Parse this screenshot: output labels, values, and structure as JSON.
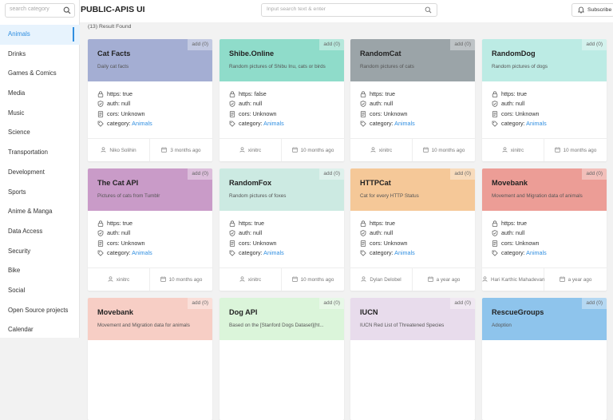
{
  "sidebar": {
    "search_placeholder": "search category",
    "items": [
      {
        "label": "Animals",
        "active": true
      },
      {
        "label": "Drinks"
      },
      {
        "label": "Games & Comics"
      },
      {
        "label": "Media"
      },
      {
        "label": "Music"
      },
      {
        "label": "Science"
      },
      {
        "label": "Transportation"
      },
      {
        "label": "Development"
      },
      {
        "label": "Sports"
      },
      {
        "label": "Anime & Manga"
      },
      {
        "label": "Data Access"
      },
      {
        "label": "Security"
      },
      {
        "label": "Bike"
      },
      {
        "label": "Social"
      },
      {
        "label": "Open Source projects"
      },
      {
        "label": "Calendar"
      }
    ]
  },
  "header": {
    "title": "PUBLIC-APIS UI",
    "search_placeholder": "Input search text & enter",
    "subscribe_label": "Subscribe"
  },
  "results": {
    "count_text": "(13) Result Found"
  },
  "labels": {
    "https_prefix": "https: ",
    "auth_prefix": "auth: ",
    "cors_prefix": "cors: ",
    "category_prefix": "category: "
  },
  "cards": [
    {
      "title": "Cat Facts",
      "desc": "Daily cat facts",
      "color": "#a4aed3",
      "add": "add (0)",
      "https": "true",
      "auth": "null",
      "cors": "Unknown",
      "category": "Animals",
      "author": "Niko Solihin",
      "time": "3 months ago"
    },
    {
      "title": "Shibe.Online",
      "desc": "Random pictures of Shibu Inu, cats or birds",
      "color": "#8fdcca",
      "add": "add (0)",
      "https": "false",
      "auth": "null",
      "cors": "Unknown",
      "category": "Animals",
      "author": "xinitrc",
      "time": "10 months ago"
    },
    {
      "title": "RandomCat",
      "desc": "Random pictures of cats",
      "color": "#9ba4a8",
      "add": "add (0)",
      "https": "true",
      "auth": "null",
      "cors": "Unknown",
      "category": "Animals",
      "author": "xinitrc",
      "time": "10 months ago"
    },
    {
      "title": "RandomDog",
      "desc": "Random pictures of dogs",
      "color": "#bcebe4",
      "add": "add (0)",
      "https": "true",
      "auth": "null",
      "cors": "Unknown",
      "category": "Animals",
      "author": "xinitrc",
      "time": "10 months ago"
    },
    {
      "title": "The Cat API",
      "desc": "Pictures of cats from Tumblr",
      "color": "#c99bc8",
      "add": "add (0)",
      "https": "true",
      "auth": "null",
      "cors": "Unknown",
      "category": "Animals",
      "author": "xinitrc",
      "time": "10 months ago"
    },
    {
      "title": "RandomFox",
      "desc": "Random pictures of foxes",
      "color": "#cceae2",
      "add": "add (0)",
      "https": "true",
      "auth": "null",
      "cors": "Unknown",
      "category": "Animals",
      "author": "xinitrc",
      "time": "10 months ago"
    },
    {
      "title": "HTTPCat",
      "desc": "Cat for every HTTP Status",
      "color": "#f5c898",
      "add": "add (0)",
      "https": "true",
      "auth": "null",
      "cors": "Unknown",
      "category": "Animals",
      "author": "Dylan Delobel",
      "time": "a year ago"
    },
    {
      "title": "Movebank",
      "desc": "Movement and Migration data of animals",
      "color": "#ec9d96",
      "add": "add (0)",
      "https": "true",
      "auth": "null",
      "cors": "Unknown",
      "category": "Animals",
      "author": "Hari Karthic Mahadevan",
      "time": "a year ago"
    },
    {
      "title": "Movebank",
      "desc": "Movement and Migration data for animals",
      "color": "#f7cec5",
      "add": "add (0)"
    },
    {
      "title": "Dog API",
      "desc": "Based on the [Stanford Dogs Dataset](ht...",
      "color": "#dbf5da",
      "add": "add (0)"
    },
    {
      "title": "IUCN",
      "desc": "IUCN Red List of Threatened Species",
      "color": "#e8dcec",
      "add": "add (0)"
    },
    {
      "title": "RescueGroups",
      "desc": "Adoption",
      "color": "#8ec4ec",
      "add": "add (0)"
    }
  ]
}
